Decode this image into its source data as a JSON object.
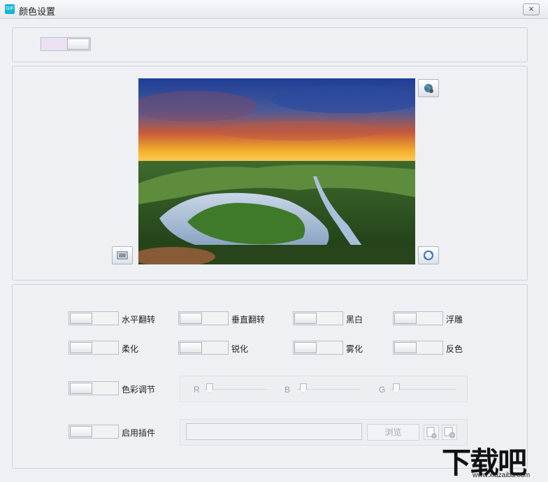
{
  "window": {
    "title": "颜色设置",
    "app_icon_text": "GIF",
    "close_label": "×"
  },
  "preview": {
    "top_right_icon": "globe-settings-icon",
    "bottom_left_icon": "barcode-icon",
    "bottom_right_icon": "refresh-icon"
  },
  "effects": {
    "row1": [
      "水平翻转",
      "垂直翻转",
      "黑白",
      "浮雕"
    ],
    "row2": [
      "柔化",
      "锐化",
      "雾化",
      "反色"
    ],
    "color_adjust_label": "色彩调节",
    "plugin_label": "启用插件"
  },
  "sliders": {
    "r": "R",
    "b": "B",
    "g": "G"
  },
  "plugin": {
    "path_value": "",
    "browse_label": "浏览"
  },
  "watermark": {
    "text": "下载吧",
    "url": "www.xiazaiba.com"
  }
}
